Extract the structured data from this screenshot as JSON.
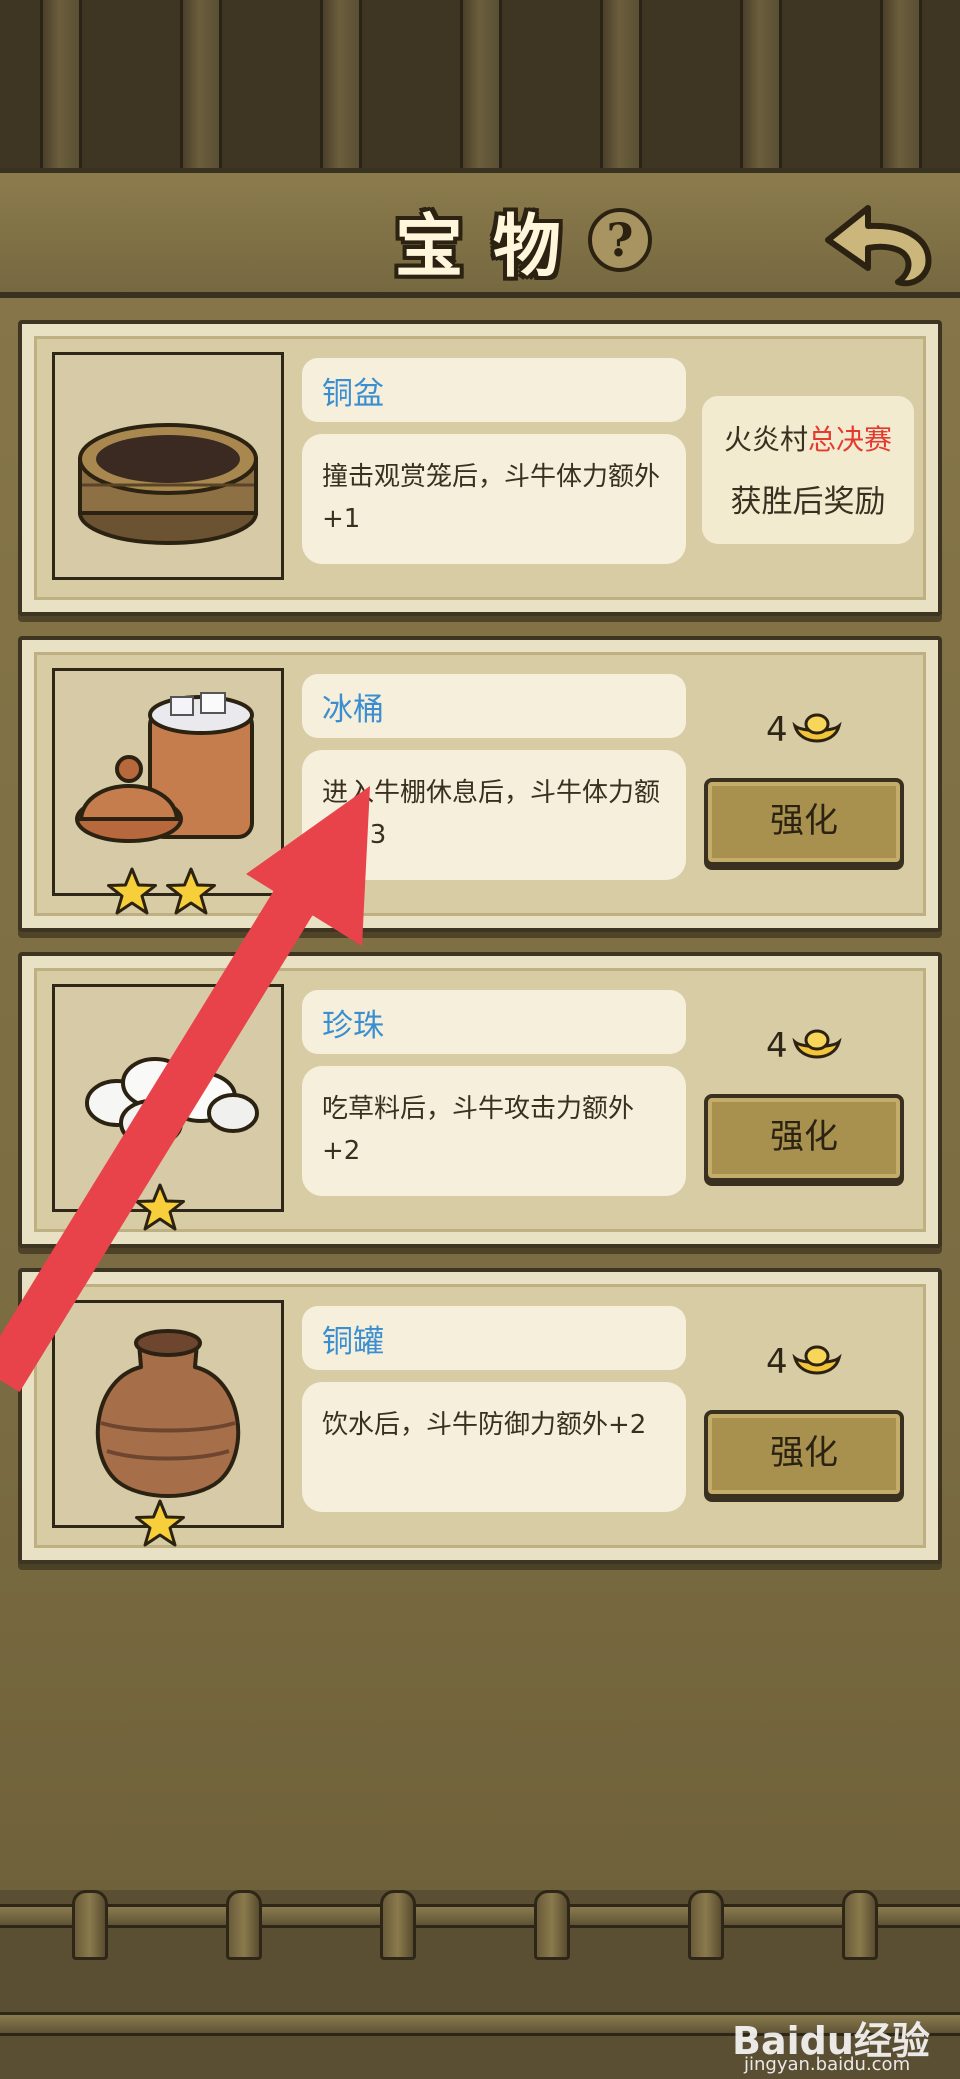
{
  "header": {
    "title": "宝物",
    "help_icon": "question-mark",
    "back_icon": "curved-back-arrow"
  },
  "treasures": [
    {
      "name": "铜盆",
      "description": "撞击观赏笼后，斗牛体力额外+1",
      "icon": "copper-basin",
      "stars": 0,
      "reward": {
        "prefix": "火炎村",
        "highlight": "总决赛",
        "line2": "获胜后奖励"
      }
    },
    {
      "name": "冰桶",
      "description": "进入牛棚休息后，斗牛体力额外+3",
      "icon": "ice-bucket",
      "stars": 2,
      "cost": "4",
      "button_label": "强化"
    },
    {
      "name": "珍珠",
      "description": "吃草料后，斗牛攻击力额外+2",
      "icon": "pearls",
      "stars": 1,
      "cost": "4",
      "button_label": "强化"
    },
    {
      "name": "铜罐",
      "description": "饮水后，斗牛防御力额外+2",
      "icon": "copper-jar",
      "stars": 1,
      "cost": "4",
      "button_label": "强化"
    }
  ],
  "currency_icon": "gold-ingot",
  "colors": {
    "name_text": "#3b8fd1",
    "highlight_red": "#e53a2f",
    "arrow_red": "#e8434b"
  },
  "watermark": {
    "logo": "Baidu经验",
    "site": "jingyan.baidu.com"
  }
}
